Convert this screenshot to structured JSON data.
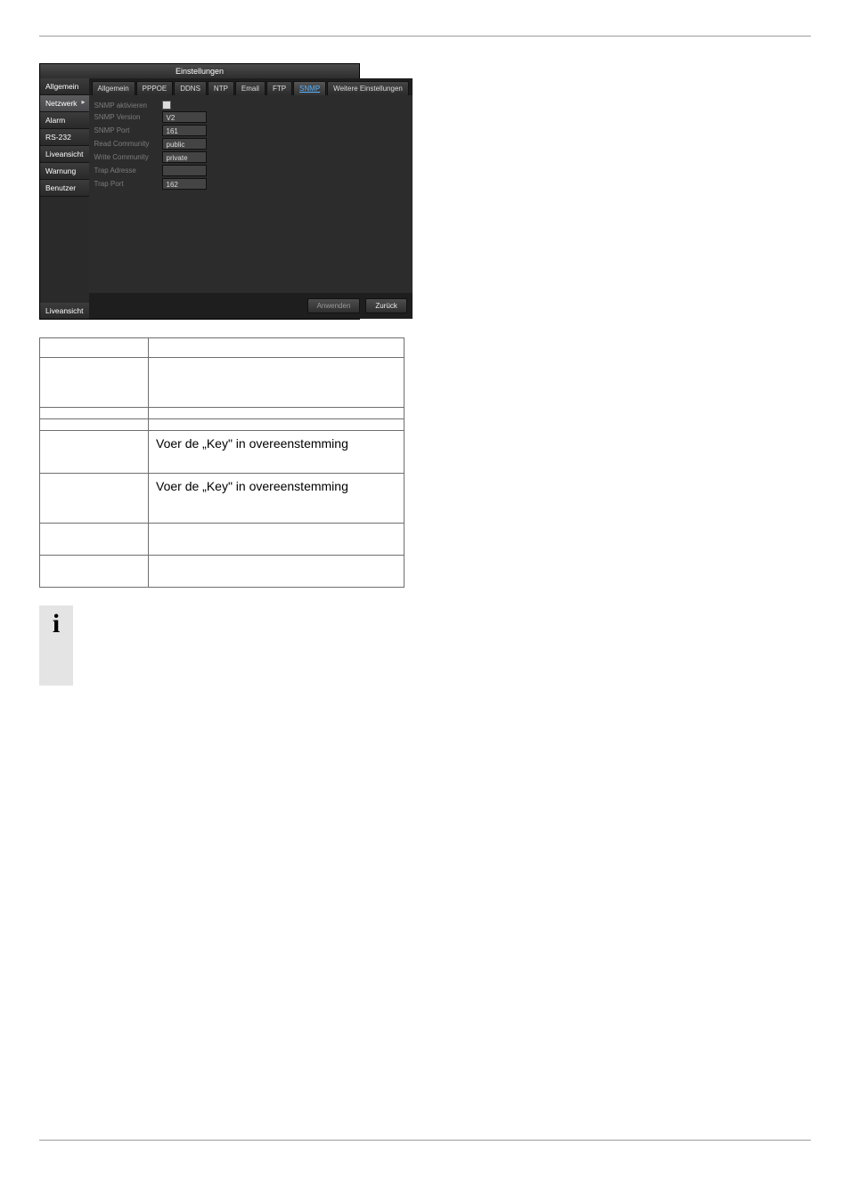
{
  "app": {
    "title": "Einstellungen",
    "sidebar": {
      "items": [
        {
          "label": "Allgemein",
          "selected": false
        },
        {
          "label": "Netzwerk",
          "selected": true
        },
        {
          "label": "Alarm",
          "selected": false
        },
        {
          "label": "RS-232",
          "selected": false
        },
        {
          "label": "Liveansicht",
          "selected": false
        },
        {
          "label": "Warnung",
          "selected": false
        },
        {
          "label": "Benutzer",
          "selected": false
        }
      ],
      "bottom": "Liveansicht"
    },
    "tabs": [
      {
        "label": "Allgemein",
        "active": false
      },
      {
        "label": "PPPOE",
        "active": false
      },
      {
        "label": "DDNS",
        "active": false
      },
      {
        "label": "NTP",
        "active": false
      },
      {
        "label": "Email",
        "active": false
      },
      {
        "label": "FTP",
        "active": false
      },
      {
        "label": "SNMP",
        "active": true
      },
      {
        "label": "Weitere Einstellungen",
        "active": false
      }
    ],
    "form": {
      "enable_label": "SNMP aktivieren",
      "rows": [
        {
          "label": "SNMP Version",
          "value": "V2"
        },
        {
          "label": "SNMP Port",
          "value": "161"
        },
        {
          "label": "Read Community",
          "value": "public"
        },
        {
          "label": "Write Community",
          "value": "private"
        },
        {
          "label": "Trap Adresse",
          "value": ""
        },
        {
          "label": "Trap Port",
          "value": "162"
        }
      ]
    },
    "buttons": {
      "apply": "Anwenden",
      "back": "Zurück"
    }
  },
  "table": {
    "header": [
      "",
      ""
    ],
    "rows": [
      {
        "k": "",
        "v": ""
      },
      {
        "k": "",
        "v": ""
      },
      {
        "k": "",
        "v": ""
      },
      {
        "k": "",
        "v": "Voer de „Key\" in overeenstemming"
      },
      {
        "k": "",
        "v": "Voer de „Key\" in overeenstemming"
      },
      {
        "k": "",
        "v": ""
      },
      {
        "k": "",
        "v": ""
      }
    ]
  },
  "info": {
    "icon": "i",
    "body": ""
  }
}
